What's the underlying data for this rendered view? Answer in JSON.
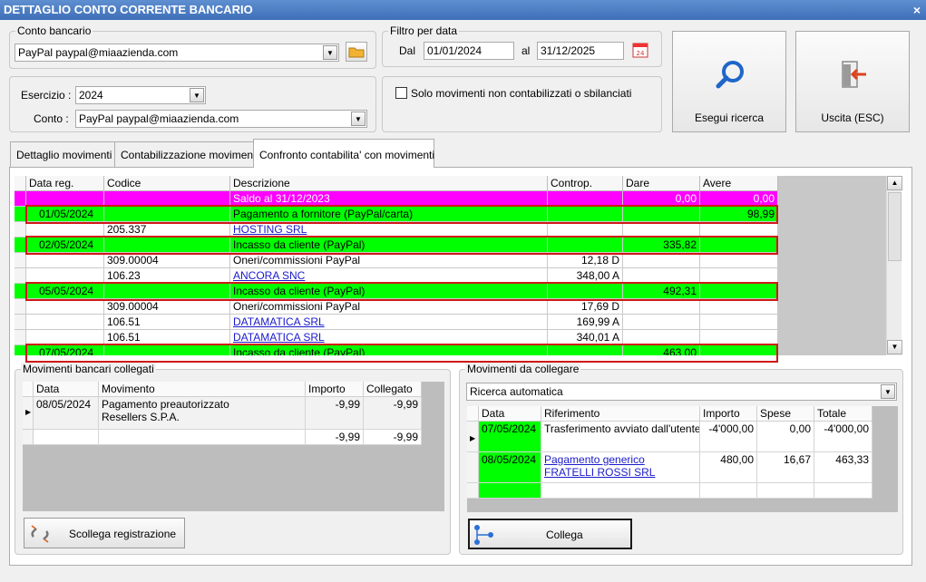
{
  "window": {
    "title": "DETTAGLIO CONTO CORRENTE BANCARIO",
    "close": "×"
  },
  "conto_bancario": {
    "legend": "Conto bancario",
    "value": "PayPal paypal@miaazienda.com"
  },
  "filtro": {
    "legend": "Filtro per data",
    "dal_label": "Dal",
    "dal_value": "01/01/2024",
    "al_label": "al",
    "al_value": "31/12/2025",
    "calendar_day": "24"
  },
  "esercizio": {
    "label": "Esercizio :",
    "value": "2024",
    "conto_label": "Conto :",
    "conto_value": "PayPal paypal@miaazienda.com"
  },
  "solo_movimenti": {
    "label": "Solo movimenti non contabilizzati o sbilanciati",
    "checked": false
  },
  "buttons": {
    "search": "Esegui ricerca",
    "exit": "Uscita (ESC)"
  },
  "tabs": [
    {
      "label": "Dettaglio movimenti"
    },
    {
      "label": "Contabilizzazione movimenti"
    },
    {
      "label": "Confronto contabilita' con movimenti"
    }
  ],
  "grid": {
    "headers": [
      "Data reg.",
      "Codice",
      "Descrizione",
      "Controp.",
      "Dare",
      "Avere"
    ],
    "rows": [
      {
        "style": "magenta",
        "data": "",
        "codice": "",
        "descrizione": "Saldo al 31/12/2023",
        "controp": "",
        "dare": "0,00",
        "avere": "0,00",
        "link": false
      },
      {
        "style": "green",
        "data": "01/05/2024",
        "codice": "",
        "descrizione": "Pagamento a fornitore (PayPal/carta)",
        "controp": "",
        "dare": "",
        "avere": "98,99",
        "link": false
      },
      {
        "style": "plain",
        "data": "",
        "codice": "205.337",
        "descrizione": "HOSTING SRL",
        "controp": "",
        "dare": "",
        "avere": "",
        "link": true
      },
      {
        "style": "green",
        "data": "02/05/2024",
        "codice": "",
        "descrizione": "Incasso da cliente (PayPal)",
        "controp": "",
        "dare": "335,82",
        "avere": "",
        "link": false
      },
      {
        "style": "plain",
        "data": "",
        "codice": "309.00004",
        "descrizione": "Oneri/commissioni PayPal",
        "controp": "12,18 D",
        "dare": "",
        "avere": "",
        "link": false
      },
      {
        "style": "plain",
        "data": "",
        "codice": "106.23",
        "descrizione": "ANCORA SNC",
        "controp": "348,00 A",
        "dare": "",
        "avere": "",
        "link": true
      },
      {
        "style": "green",
        "data": "05/05/2024",
        "codice": "",
        "descrizione": "Incasso da cliente (PayPal)",
        "controp": "",
        "dare": "492,31",
        "avere": "",
        "link": false
      },
      {
        "style": "plain",
        "data": "",
        "codice": "309.00004",
        "descrizione": "Oneri/commissioni PayPal",
        "controp": "17,69 D",
        "dare": "",
        "avere": "",
        "link": false
      },
      {
        "style": "plain",
        "data": "",
        "codice": "106.51",
        "descrizione": "DATAMATICA SRL",
        "controp": "169,99 A",
        "dare": "",
        "avere": "",
        "link": true
      },
      {
        "style": "plain",
        "data": "",
        "codice": "106.51",
        "descrizione": "DATAMATICA SRL",
        "controp": "340,01 A",
        "dare": "",
        "avere": "",
        "link": true
      },
      {
        "style": "green",
        "data": "07/05/2024",
        "codice": "",
        "descrizione": "Incasso da cliente (PayPal)",
        "controp": "",
        "dare": "463,00",
        "avere": "",
        "link": false
      }
    ]
  },
  "collegati": {
    "legend": "Movimenti bancari collegati",
    "headers": [
      "Data",
      "Movimento",
      "Importo",
      "Collegato"
    ],
    "row": {
      "data": "08/05/2024",
      "movimento_1": "Pagamento preautorizzato",
      "movimento_2": "Resellers S.P.A.",
      "importo": "-9,99",
      "collegato": "-9,99"
    },
    "totals": {
      "importo": "-9,99",
      "collegato": "-9,99"
    },
    "button": "Scollega registrazione"
  },
  "da_collegare": {
    "legend": "Movimenti da collegare",
    "mode": "Ricerca automatica",
    "headers": [
      "Data",
      "Riferimento",
      "Importo",
      "Spese",
      "Totale"
    ],
    "rows": [
      {
        "data": "07/05/2024",
        "rif_1": "Trasferimento avviato dall'utente",
        "rif_2": "",
        "importo": "-4'000,00",
        "spese": "0,00",
        "totale": "-4'000,00",
        "link": false
      },
      {
        "data": "08/05/2024",
        "rif_1": "Pagamento generico",
        "rif_2": "FRATELLI ROSSI SRL",
        "importo": "480,00",
        "spese": "16,67",
        "totale": "463,33",
        "link": true
      }
    ],
    "button": "Collega"
  },
  "colors": {
    "green": "#00ff00",
    "magenta": "#ff00ff",
    "highlight": "#d01818",
    "link": "#1a1acc"
  }
}
